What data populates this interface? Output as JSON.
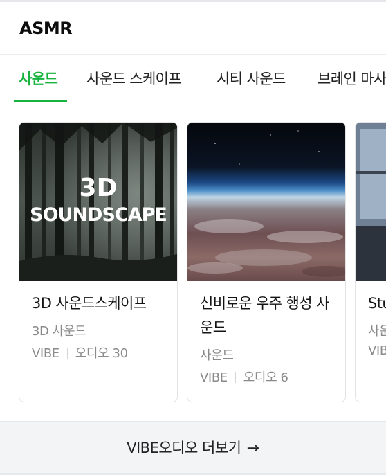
{
  "header": {
    "title": "ASMR"
  },
  "tabs": [
    {
      "label": "사운드",
      "active": true
    },
    {
      "label": "사운드 스케이프",
      "active": false
    },
    {
      "label": "시티 사운드",
      "active": false
    },
    {
      "label": "브레인 마사지",
      "active": false
    }
  ],
  "cards": [
    {
      "thumbnail_text_line1": "3D",
      "thumbnail_text_line2": "SOUNDSCAPE",
      "title": "3D 사운드스케이프",
      "subtitle": "3D 사운드",
      "source": "VIBE",
      "count": "오디오 30"
    },
    {
      "title": "신비로운 우주 행성 사운드",
      "subtitle": "사운드",
      "source": "VIBE",
      "count": "오디오 6"
    },
    {
      "title": "Stu",
      "subtitle": "사운",
      "source": "VIB"
    }
  ],
  "more": {
    "label": "VIBE오디오 더보기",
    "arrow": "→"
  },
  "colors": {
    "accent": "#16b33e"
  }
}
